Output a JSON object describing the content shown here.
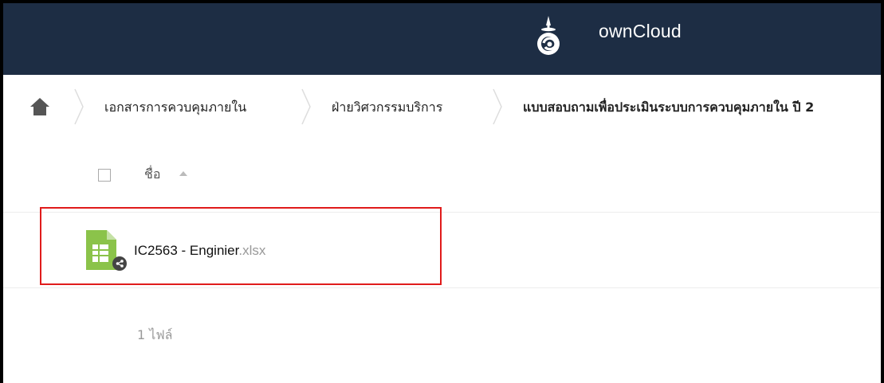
{
  "header": {
    "app_name": "ownCloud",
    "logo_icon": "owncloud-logo-icon",
    "background_color": "#1d2d44"
  },
  "breadcrumb": {
    "home_icon": "home-icon",
    "items": [
      {
        "label": "เอกสารการควบคุมภายใน"
      },
      {
        "label": "ฝ่ายวิศวกรรมบริการ"
      },
      {
        "label": "แบบสอบถามเพื่อประเมินระบบการควบคุมภายใน ปี 2"
      }
    ]
  },
  "file_list": {
    "select_all_checked": false,
    "name_column_label": "ชื่อ",
    "sort": "ascending",
    "files": [
      {
        "base_name": "IC2563 - Enginier",
        "extension": ".xlsx",
        "icon": "spreadsheet-icon",
        "shared": true,
        "icon_color": "#8bc34a"
      }
    ],
    "summary": "1 ไฟล์"
  },
  "annotation": {
    "highlight_color": "#e01b1b"
  }
}
